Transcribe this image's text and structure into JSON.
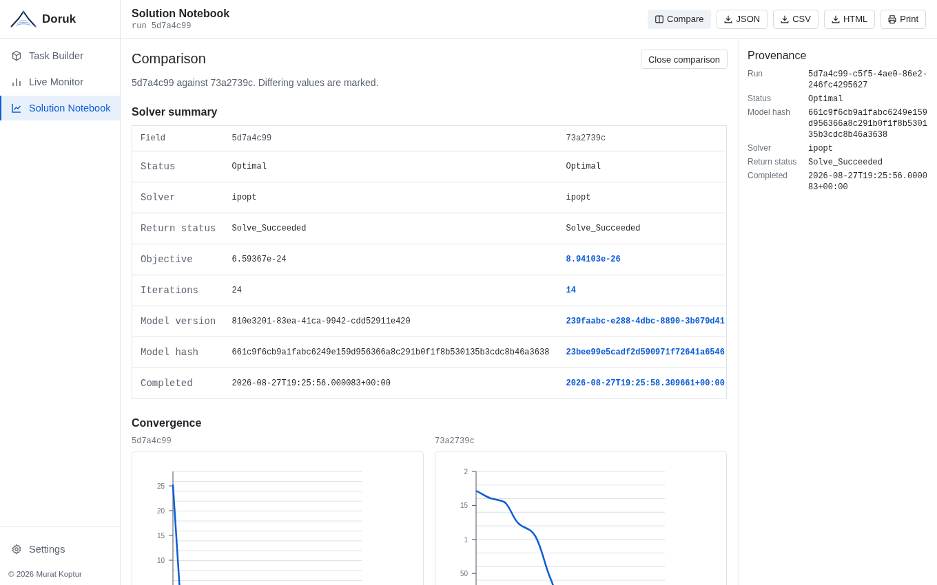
{
  "sidebar": {
    "brand": "Doruk",
    "items": [
      {
        "label": "Task Builder",
        "kind": "builder",
        "selected": false
      },
      {
        "label": "Live Monitor",
        "kind": "monitor",
        "selected": false
      },
      {
        "label": "Solution Notebook",
        "kind": "notebook",
        "selected": true
      }
    ],
    "footer_item": {
      "label": "Settings"
    },
    "copyright": "© 2026 Murat Koptur"
  },
  "header": {
    "title": "Solution Notebook",
    "subtitle": "run 5d7a4c99",
    "actions": [
      {
        "label": "Compare",
        "kind": "toggle",
        "selected": true
      },
      {
        "label": "JSON",
        "kind": "download"
      },
      {
        "label": "CSV",
        "kind": "download"
      },
      {
        "label": "HTML",
        "kind": "download"
      },
      {
        "label": "Print",
        "kind": "print"
      }
    ]
  },
  "comparison": {
    "title": "Comparison",
    "close_button": "Close comparison",
    "description": "5d7a4c99 against 73a2739c. Differing values are marked."
  },
  "summary": {
    "title": "Solver summary",
    "columns": [
      "Field",
      "5d7a4c99",
      "73a2739c"
    ],
    "rows": [
      {
        "field": "Status",
        "a": "Optimal",
        "b": "Optimal",
        "differs": false
      },
      {
        "field": "Solver",
        "a": "ipopt",
        "b": "ipopt",
        "differs": false
      },
      {
        "field": "Return status",
        "a": "Solve_Succeeded",
        "b": "Solve_Succeeded",
        "differs": false
      },
      {
        "field": "Objective",
        "a": "6.59367e-24",
        "b": "8.94103e-26",
        "differs": true
      },
      {
        "field": "Iterations",
        "a": "24",
        "b": "14",
        "differs": true
      },
      {
        "field": "Model version",
        "a": "810e3201-83ea-41ca-9942-cdd52911e420",
        "b": "239faabc-e288-4dbc-8890-3b079d41",
        "differs": true
      },
      {
        "field": "Model hash",
        "a": "661c9f6cb9a1fabc6249e159d956366a8c291b0f1f8b530135b3cdc8b46a3638",
        "b": "23bee99e5cadf2d590971f72641a6546",
        "differs": true
      },
      {
        "field": "Completed",
        "a": "2026-08-27T19:25:56.000083+00:00",
        "b": "2026-08-27T19:25:58.309661+00:00",
        "differs": true
      }
    ]
  },
  "convergence": {
    "title": "Convergence",
    "panels": [
      {
        "label": "5d7a4c99",
        "kind": "steep",
        "y_tick_labels": [
          "25",
          "20",
          "15",
          "10"
        ]
      },
      {
        "label": "73a2739c",
        "kind": "gradual",
        "y_tick_labels": [
          "2",
          "15",
          "1",
          "50"
        ]
      }
    ]
  },
  "provenance": {
    "title": "Provenance",
    "fields": [
      {
        "label": "Run",
        "value": "5d7a4c99-c5f5-4ae0-86e2-246fc4295627"
      },
      {
        "label": "Status",
        "value": "Optimal"
      },
      {
        "label": "Model hash",
        "value": "661c9f6cb9a1fabc6249e159d956366a8c291b0f1f8b530135b3cdc8b46a3638"
      },
      {
        "label": "Solver",
        "value": "ipopt"
      },
      {
        "label": "Return status",
        "value": "Solve_Succeeded"
      },
      {
        "label": "Completed",
        "value": "2026-08-27T19:25:56.000083+00:00"
      }
    ]
  }
}
